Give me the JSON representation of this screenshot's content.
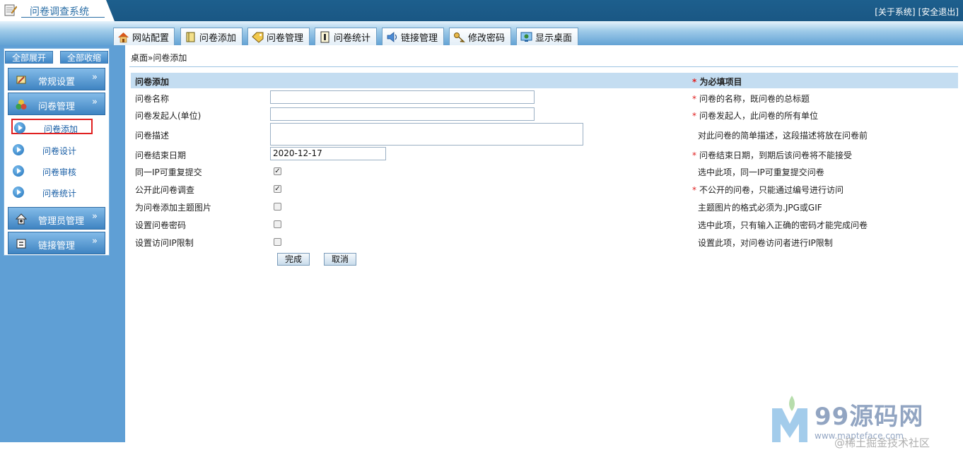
{
  "app": {
    "title": "问卷调查系统",
    "top_links": [
      "[关于系统]",
      "[安全退出]"
    ]
  },
  "tabs": [
    {
      "label": "网站配置",
      "icon": "home-icon"
    },
    {
      "label": "问卷添加",
      "icon": "book-icon"
    },
    {
      "label": "问卷管理",
      "icon": "tag-icon"
    },
    {
      "label": "问卷统计",
      "icon": "document-icon"
    },
    {
      "label": "链接管理",
      "icon": "speaker-icon"
    },
    {
      "label": "修改密码",
      "icon": "key-icon"
    },
    {
      "label": "显示桌面",
      "icon": "desktop-icon"
    }
  ],
  "sidebar": {
    "expand_all": "全部展开",
    "collapse_all": "全部收缩",
    "groups": [
      {
        "label": "常规设置",
        "icon": "settings-icon",
        "chevron": "»"
      },
      {
        "label": "问卷管理",
        "icon": "survey-icon",
        "chevron": "»"
      },
      {
        "label": "管理员管理",
        "icon": "admin-icon",
        "chevron": "»"
      },
      {
        "label": "链接管理",
        "icon": "link-icon",
        "chevron": "»"
      }
    ],
    "sub_items": [
      {
        "label": "问卷添加",
        "selected": true
      },
      {
        "label": "问卷设计",
        "selected": false
      },
      {
        "label": "问卷审核",
        "selected": false
      },
      {
        "label": "问卷统计",
        "selected": false
      }
    ]
  },
  "main": {
    "breadcrumb": "桌面»问卷添加",
    "form_title": "问卷添加",
    "required_note_star": "*",
    "required_note": "为必填项目",
    "fields": [
      {
        "label": "问卷名称",
        "type": "text",
        "value": "",
        "required": true,
        "note": "问卷的名称，既问卷的总标题"
      },
      {
        "label": "问卷发起人(单位)",
        "type": "text",
        "value": "",
        "required": true,
        "note": "问卷发起人，此问卷的所有单位"
      },
      {
        "label": "问卷描述",
        "type": "textarea",
        "value": "",
        "required": false,
        "note": "对此问卷的简单描述，这段描述将放在问卷前"
      },
      {
        "label": "问卷结束日期",
        "type": "date",
        "value": "2020-12-17",
        "required": true,
        "note": "问卷结束日期，到期后该问卷将不能接受"
      },
      {
        "label": "同一IP可重复提交",
        "type": "checkbox",
        "checked": true,
        "required": false,
        "note": "选中此项，同一IP可重复提交问卷"
      },
      {
        "label": "公开此问卷调查",
        "type": "checkbox",
        "checked": true,
        "required": true,
        "note": "不公开的问卷，只能通过编号进行访问"
      },
      {
        "label": "为问卷添加主题图片",
        "type": "checkbox",
        "checked": false,
        "required": false,
        "note": "主题图片的格式必须为.JPG或GIF"
      },
      {
        "label": "设置问卷密码",
        "type": "checkbox",
        "checked": false,
        "required": false,
        "note": "选中此项，只有输入正确的密码才能完成问卷"
      },
      {
        "label": "设置访问IP限制",
        "type": "checkbox",
        "checked": false,
        "required": false,
        "note": "设置此项，对问卷访问者进行IP限制"
      }
    ],
    "submit_label": "完成",
    "cancel_label": "取消",
    "check_mark": "✓",
    "required_star": "*"
  },
  "watermark": {
    "title": "99源码网",
    "url": "www.mapteface.com",
    "credit": "@稀土掘金技术社区"
  },
  "colors": {
    "header_blue": "#1d5f8d",
    "sidebar_blue": "#5f9fd5",
    "form_head": "#c4ddf1",
    "required_red": "#e02020",
    "selection_red": "#e02020"
  }
}
